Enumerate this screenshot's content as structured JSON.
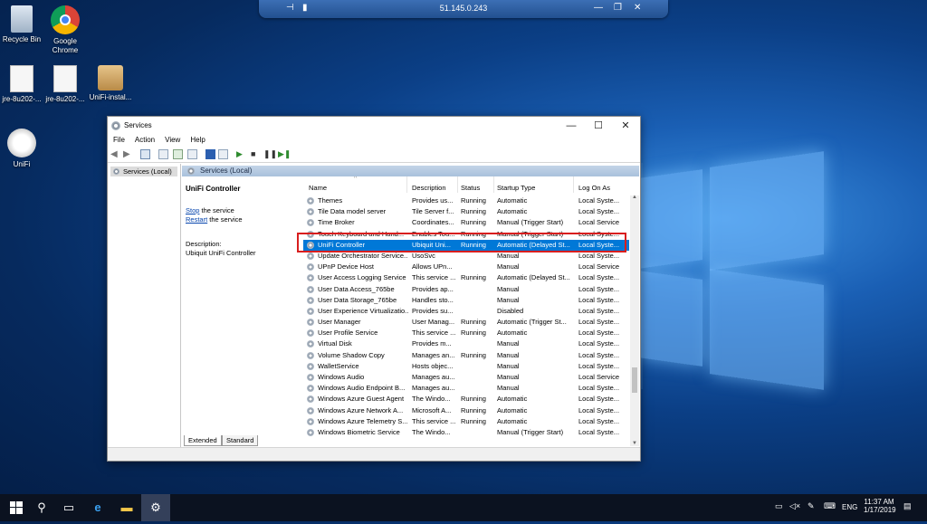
{
  "desktop": {
    "icons": [
      {
        "label": "Recycle Bin"
      },
      {
        "label": "Google Chrome"
      },
      {
        "label": "jre-8u202-..."
      },
      {
        "label": "jre-8u202-..."
      },
      {
        "label": "UniFi-instal..."
      },
      {
        "label": "UniFi"
      }
    ]
  },
  "remote_bar": {
    "address": "51.145.0.243"
  },
  "window": {
    "title": "Services",
    "menu": [
      "File",
      "Action",
      "View",
      "Help"
    ],
    "tree_node": "Services (Local)",
    "pane_header": "Services (Local)",
    "selected_service": {
      "name": "UniFi Controller",
      "stop_link": "Stop",
      "stop_rest": " the service",
      "restart_link": "Restart",
      "restart_rest": " the service",
      "description_label": "Description:",
      "description": "Ubiquit UniFi Controller"
    },
    "columns": [
      "Name",
      "Description",
      "Status",
      "Startup Type",
      "Log On As"
    ],
    "rows": [
      {
        "name": "Themes",
        "desc": "Provides us...",
        "status": "Running",
        "startup": "Automatic",
        "logon": "Local Syste..."
      },
      {
        "name": "Tile Data model server",
        "desc": "Tile Server f...",
        "status": "Running",
        "startup": "Automatic",
        "logon": "Local Syste..."
      },
      {
        "name": "Time Broker",
        "desc": "Coordinates...",
        "status": "Running",
        "startup": "Manual (Trigger Start)",
        "logon": "Local Service"
      },
      {
        "name": "Touch Keyboard and Hand...",
        "desc": "Enables Tou...",
        "status": "Running",
        "startup": "Manual (Trigger Start)",
        "logon": "Local Syste..."
      },
      {
        "name": "UniFi Controller",
        "desc": "Ubiquit Uni...",
        "status": "Running",
        "startup": "Automatic (Delayed St...",
        "logon": "Local Syste...",
        "selected": true
      },
      {
        "name": "Update Orchestrator Service...",
        "desc": "UsoSvc",
        "status": "",
        "startup": "Manual",
        "logon": "Local Syste..."
      },
      {
        "name": "UPnP Device Host",
        "desc": "Allows UPn...",
        "status": "",
        "startup": "Manual",
        "logon": "Local Service"
      },
      {
        "name": "User Access Logging Service",
        "desc": "This service ...",
        "status": "Running",
        "startup": "Automatic (Delayed St...",
        "logon": "Local Syste..."
      },
      {
        "name": "User Data Access_765be",
        "desc": "Provides ap...",
        "status": "",
        "startup": "Manual",
        "logon": "Local Syste..."
      },
      {
        "name": "User Data Storage_765be",
        "desc": "Handles sto...",
        "status": "",
        "startup": "Manual",
        "logon": "Local Syste..."
      },
      {
        "name": "User Experience Virtualizatio...",
        "desc": "Provides su...",
        "status": "",
        "startup": "Disabled",
        "logon": "Local Syste..."
      },
      {
        "name": "User Manager",
        "desc": "User Manag...",
        "status": "Running",
        "startup": "Automatic (Trigger St...",
        "logon": "Local Syste..."
      },
      {
        "name": "User Profile Service",
        "desc": "This service ...",
        "status": "Running",
        "startup": "Automatic",
        "logon": "Local Syste..."
      },
      {
        "name": "Virtual Disk",
        "desc": "Provides m...",
        "status": "",
        "startup": "Manual",
        "logon": "Local Syste..."
      },
      {
        "name": "Volume Shadow Copy",
        "desc": "Manages an...",
        "status": "Running",
        "startup": "Manual",
        "logon": "Local Syste..."
      },
      {
        "name": "WalletService",
        "desc": "Hosts objec...",
        "status": "",
        "startup": "Manual",
        "logon": "Local Syste..."
      },
      {
        "name": "Windows Audio",
        "desc": "Manages au...",
        "status": "",
        "startup": "Manual",
        "logon": "Local Service"
      },
      {
        "name": "Windows Audio Endpoint B...",
        "desc": "Manages au...",
        "status": "",
        "startup": "Manual",
        "logon": "Local Syste..."
      },
      {
        "name": "Windows Azure Guest Agent",
        "desc": "The Windo...",
        "status": "Running",
        "startup": "Automatic",
        "logon": "Local Syste..."
      },
      {
        "name": "Windows Azure Network A...",
        "desc": "Microsoft A...",
        "status": "Running",
        "startup": "Automatic",
        "logon": "Local Syste..."
      },
      {
        "name": "Windows Azure Telemetry S...",
        "desc": "This service ...",
        "status": "Running",
        "startup": "Automatic",
        "logon": "Local Syste..."
      },
      {
        "name": "Windows Biometric Service",
        "desc": "The Windo...",
        "status": "",
        "startup": "Manual (Trigger Start)",
        "logon": "Local Syste..."
      }
    ],
    "tabs": [
      "Extended",
      "Standard"
    ]
  },
  "taskbar": {
    "language": "ENG",
    "time": "11:37 AM",
    "date": "1/17/2019"
  },
  "colors": {
    "selection": "#0078d7",
    "highlight_box": "#d81e1e"
  }
}
